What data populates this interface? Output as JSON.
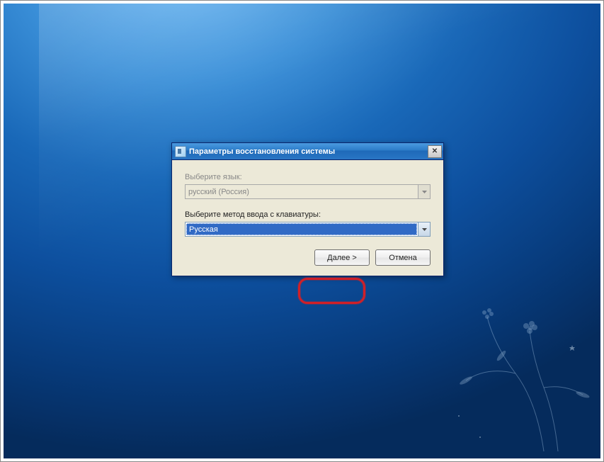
{
  "dialog": {
    "title": "Параметры восстановления системы",
    "language_label": "Выберите язык:",
    "language_value": "русский (Россия)",
    "keyboard_label": "Выберите метод ввода с клавиатуры:",
    "keyboard_value": "Русская",
    "next_button": "Далее >",
    "cancel_button": "Отмена",
    "close_glyph": "✕"
  }
}
